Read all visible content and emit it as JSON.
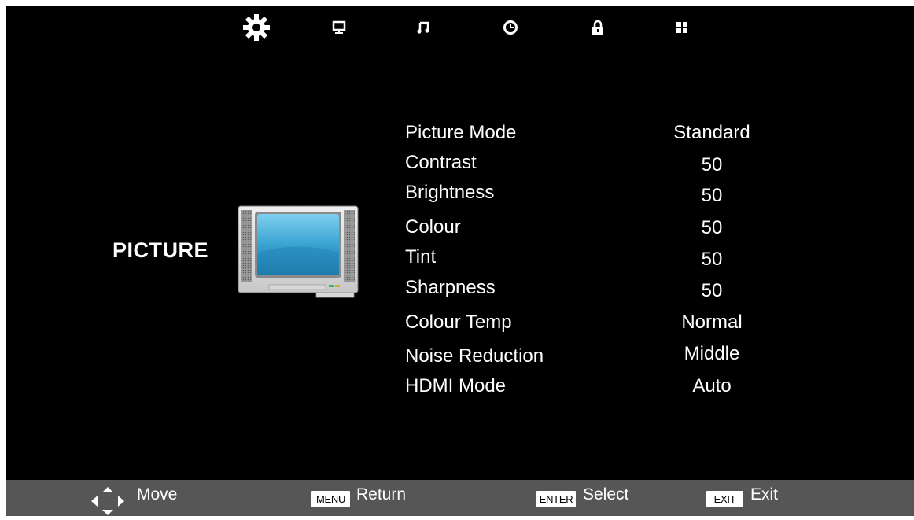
{
  "top_nav": {
    "tabs": [
      {
        "name": "picture-settings-tab",
        "icon": "gear-icon",
        "active": true
      },
      {
        "name": "screen-tab",
        "icon": "monitor-icon"
      },
      {
        "name": "sound-tab",
        "icon": "music-note-icon"
      },
      {
        "name": "time-tab",
        "icon": "clock-icon"
      },
      {
        "name": "lock-tab",
        "icon": "lock-icon"
      },
      {
        "name": "setup-tab",
        "icon": "grid-icon"
      }
    ]
  },
  "section": {
    "title": "PICTURE",
    "icon": "tv-icon",
    "tv_screen_color": "#3aa3d2"
  },
  "menu": {
    "items": [
      {
        "label": "Picture Mode",
        "value": "Standard"
      },
      {
        "label": "Contrast",
        "value": "50"
      },
      {
        "label": "Brightness",
        "value": "50"
      },
      {
        "label": "Colour",
        "value": "50"
      },
      {
        "label": "Tint",
        "value": "50"
      },
      {
        "label": "Sharpness",
        "value": "50"
      },
      {
        "label": "Colour Temp",
        "value": "Normal"
      },
      {
        "label": "Noise Reduction",
        "value": "Middle"
      },
      {
        "label": "HDMI Mode",
        "value": "Auto"
      }
    ]
  },
  "footer": {
    "move": {
      "icon": "dpad-icon",
      "label": "Move"
    },
    "return": {
      "key": "MENU",
      "label": "Return"
    },
    "select": {
      "key": "ENTER",
      "label": "Select"
    },
    "exit": {
      "key": "EXIT",
      "label": "Exit"
    }
  },
  "colors": {
    "background": "#000000",
    "footer_background": "#565656",
    "text": "#ffffff"
  }
}
